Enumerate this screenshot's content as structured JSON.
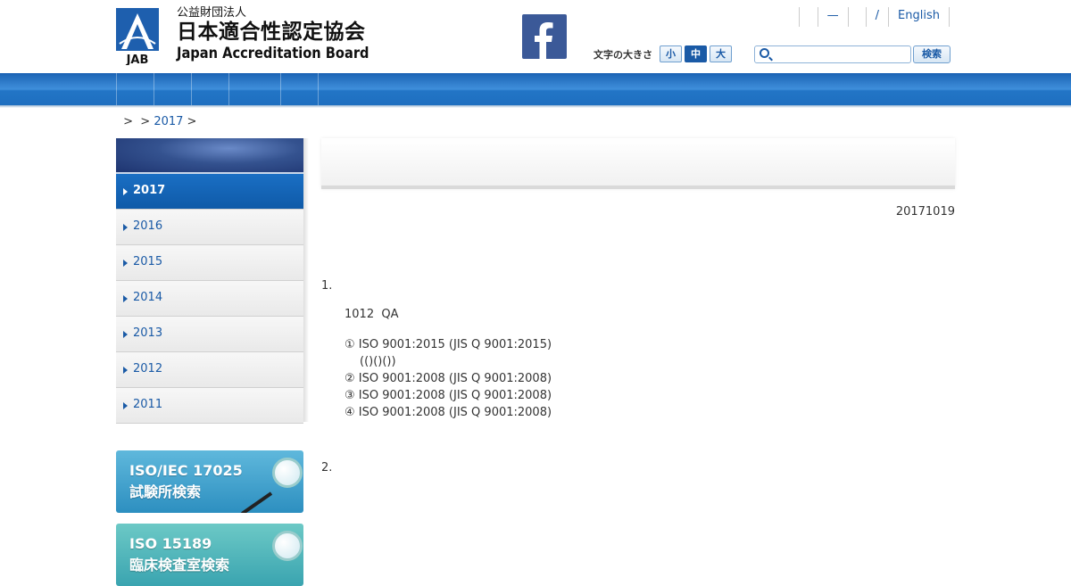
{
  "header": {
    "logo_abbr": "JAB",
    "logo_small": "公益財団法人",
    "logo_name": "日本適合性認定協会",
    "logo_en": "Japan Accreditation Board",
    "top_links": [
      "",
      "—",
      "",
      "/",
      "English"
    ],
    "font_size_label": "文字の大きさ",
    "font_sizes": [
      "小",
      "中",
      "大"
    ],
    "font_size_selected": "中",
    "search_placeholder": "",
    "search_button": "検索",
    "facebook_icon": "facebook-icon"
  },
  "nav": {
    "items": [
      "",
      "",
      "",
      "",
      ""
    ]
  },
  "breadcrumb": {
    "items": [
      "",
      "",
      "2017"
    ]
  },
  "sidebar": {
    "years": [
      "2017",
      "2016",
      "2015",
      "2014",
      "2013",
      "2012",
      "2011"
    ],
    "active": "2017",
    "banners": [
      {
        "line1": "ISO/IEC 17025",
        "line2": "試験所検索"
      },
      {
        "line1": "ISO 15189",
        "line2": "臨床検査室検索"
      }
    ]
  },
  "main": {
    "title": "",
    "date": "20171019",
    "sections": [
      {
        "number": "1.",
        "lead": "1012  QA",
        "items": [
          {
            "mark": "①",
            "text": "ISO 9001:2015 (JIS Q 9001:2015)",
            "note": "(()()())"
          },
          {
            "mark": "②",
            "text": "ISO 9001:2008 (JIS Q 9001:2008)"
          },
          {
            "mark": "③",
            "text": "ISO 9001:2008 (JIS Q 9001:2008)"
          },
          {
            "mark": "④",
            "text": "ISO 9001:2008 (JIS Q 9001:2008)"
          }
        ]
      },
      {
        "number": "2."
      }
    ]
  },
  "colors": {
    "accent": "#1a5aa6",
    "nav": "#2275c6",
    "facebook": "#3b5998"
  }
}
